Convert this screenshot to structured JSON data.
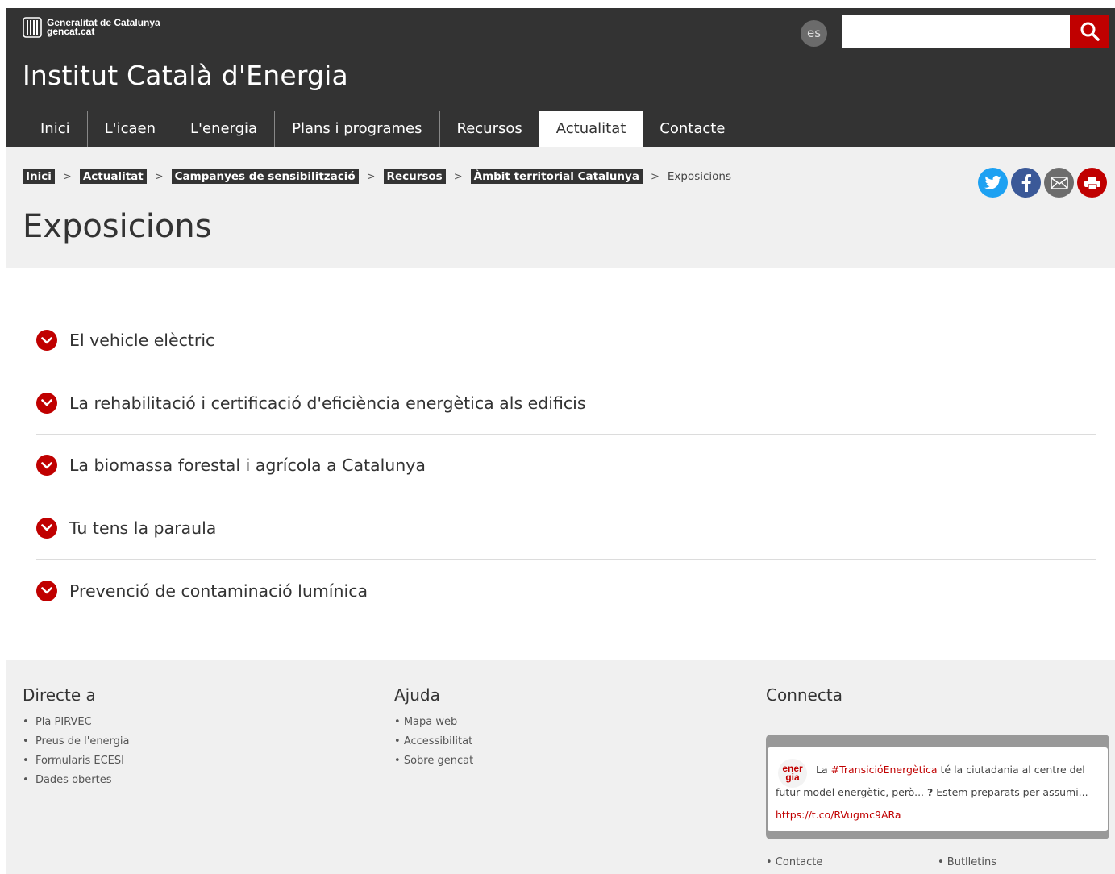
{
  "header": {
    "gencat_line1": "Generalitat de Catalunya",
    "gencat_line2": "gencat.cat",
    "lang": "es",
    "search_placeholder": "",
    "site_title": "Institut Català d'Energia",
    "nav": [
      {
        "label": "Inici",
        "active": false
      },
      {
        "label": "L'icaen",
        "active": false
      },
      {
        "label": "L'energia",
        "active": false
      },
      {
        "label": "Plans i programes",
        "active": false
      },
      {
        "label": "Recursos",
        "active": false
      },
      {
        "label": "Actualitat",
        "active": true
      },
      {
        "label": "Contacte",
        "active": false
      }
    ]
  },
  "breadcrumb": {
    "items": [
      "Inici",
      "Actualitat",
      "Campanyes de sensibilització",
      "Recursos",
      "Àmbit territorial Catalunya"
    ],
    "separator": ">",
    "current": "Exposicions"
  },
  "share": [
    "twitter-icon",
    "facebook-icon",
    "email-icon",
    "print-icon"
  ],
  "page_title": "Exposicions",
  "accordion": [
    "El vehicle elèctric",
    "La rehabilitació i certificació d'eficiència energètica als edificis",
    "La biomassa forestal i agrícola a Catalunya",
    "Tu tens la paraula",
    "Prevenció de contaminació lumínica"
  ],
  "footer": {
    "directe": {
      "title": "Directe a",
      "items": [
        "Pla PIRVEC",
        "Preus de l'energia",
        "Formularis ECESI",
        "Dades obertes"
      ]
    },
    "ajuda": {
      "title": "Ajuda",
      "items": [
        "Mapa web",
        "Accessibilitat",
        "Sobre gencat"
      ]
    },
    "connecta": {
      "title": "Connecta",
      "tweet_logo_1": "ener",
      "tweet_logo_2": "gia",
      "tweet_pre": "La ",
      "tweet_hashtag": "#TransicióEnergètica",
      "tweet_mid": " té la ciutadania al centre del futur model energètic, però... ",
      "tweet_q": "?",
      "tweet_post": " Estem preparats per assumi... ",
      "tweet_link": "https://t.co/RVugmc9ARa",
      "link_contacte": "• Contacte",
      "link_butlletins": "• Butlletins"
    }
  },
  "colors": {
    "header_bg": "#333333",
    "accent_red": "#c00000",
    "band_bg": "#f0f0f0",
    "twitter": "#1da1f2",
    "facebook": "#3b5998"
  }
}
